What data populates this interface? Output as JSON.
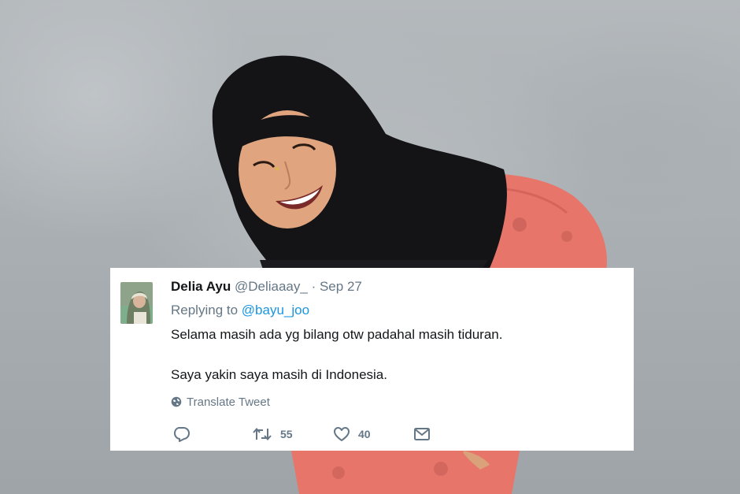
{
  "tweet": {
    "author_name": "Delia Ayu",
    "handle": "@Deliaaay_",
    "separator": "·",
    "date": "Sep 27",
    "replying_prefix": "Replying to",
    "replying_to": "@bayu_joo",
    "text_line_1": "Selama masih ada yg bilang otw padahal masih tiduran.",
    "text_line_2": "Saya yakin saya masih di Indonesia.",
    "translate_label": "Translate Tweet",
    "retweet_count": "55",
    "like_count": "40"
  },
  "icons": {
    "globe": "globe-icon",
    "reply": "reply-icon",
    "retweet": "retweet-icon",
    "like": "heart-icon",
    "message": "envelope-icon"
  },
  "colors": {
    "link": "#1b95e0",
    "muted": "#657786",
    "text": "#14171a",
    "card_bg": "#ffffff"
  }
}
